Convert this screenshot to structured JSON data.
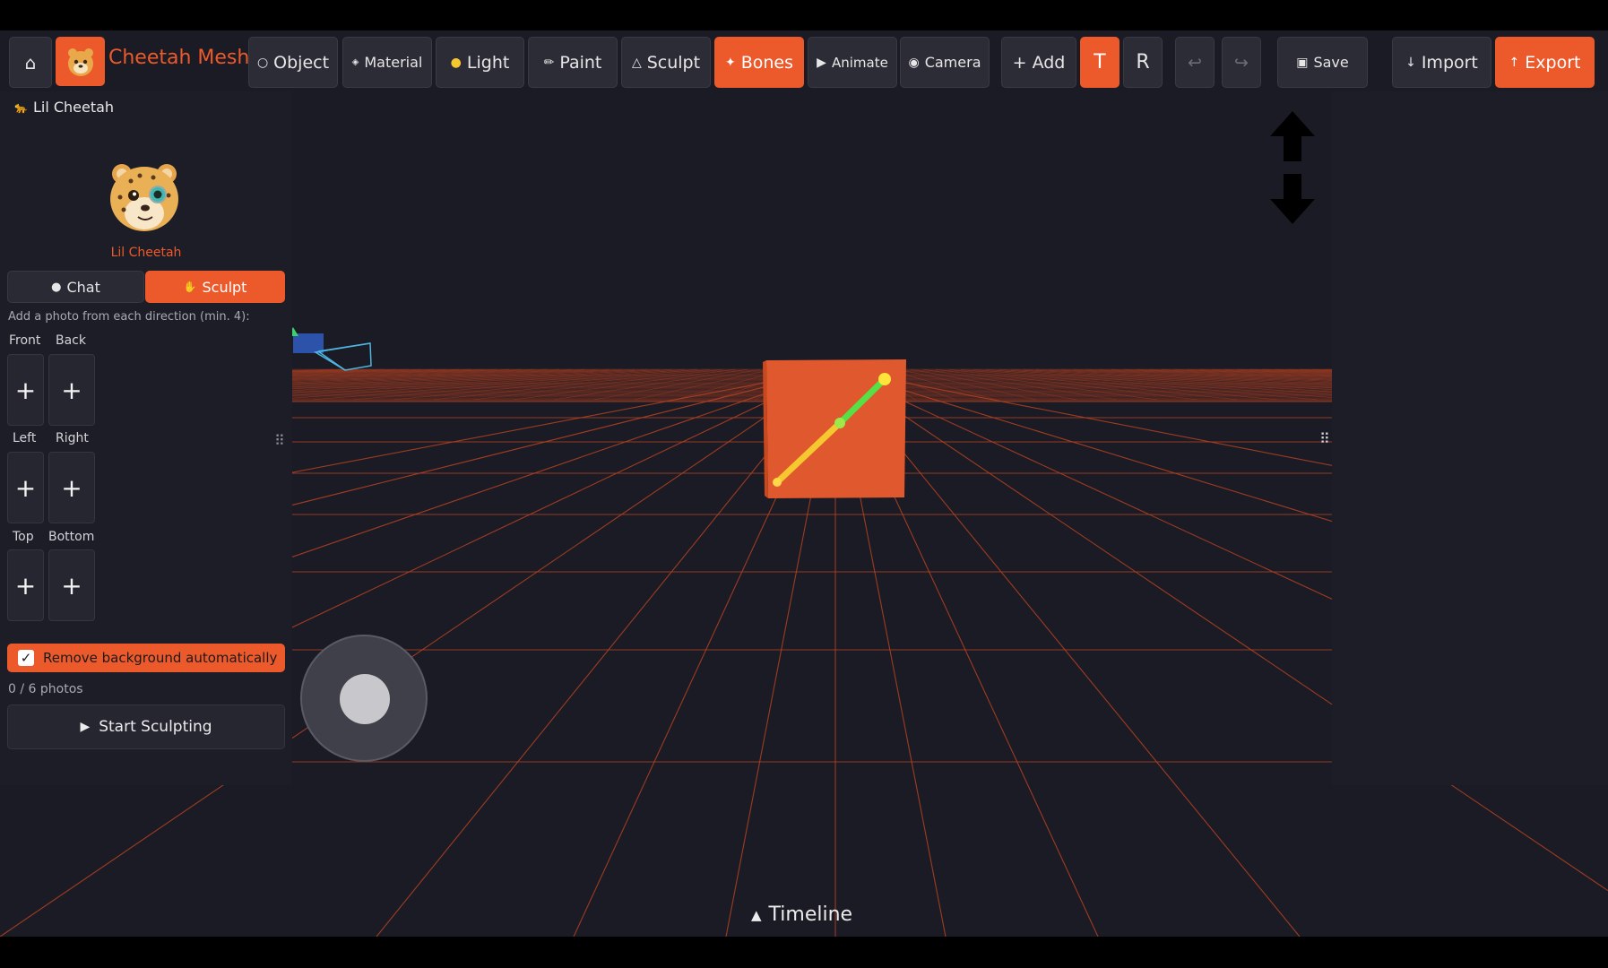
{
  "app": {
    "title": "Cheetah Mesh"
  },
  "toolbar": {
    "home_icon": "home-icon",
    "modes": [
      {
        "label": "Object",
        "icon": "○"
      },
      {
        "label": "Material",
        "icon": "◈"
      },
      {
        "label": "Light",
        "icon": "●"
      },
      {
        "label": "Paint",
        "icon": "✏"
      },
      {
        "label": "Sculpt",
        "icon": "△"
      },
      {
        "label": "Bones",
        "icon": "✦"
      },
      {
        "label": "Animate",
        "icon": "▶"
      },
      {
        "label": "Camera",
        "icon": "◉"
      }
    ],
    "active_mode": "Bones",
    "add_label": "+ Add",
    "transform_t": "T",
    "transform_r": "R",
    "undo_icon": "↩",
    "redo_icon": "↪",
    "save_label": "Save",
    "import_label": "Import",
    "export_label": "Export",
    "accent_color": "#ec5a2c"
  },
  "left_panel": {
    "header": "Lil Cheetah",
    "avatar_name": "Lil Cheetah",
    "tabs": {
      "chat": "Chat",
      "sculpt": "Sculpt"
    },
    "instructions": "Add a photo from each direction (min. 4):",
    "directions": {
      "front": "Front",
      "back": "Back",
      "left": "Left",
      "right": "Right",
      "top": "Top",
      "bottom": "Bottom"
    },
    "add_symbol": "+",
    "remove_background": {
      "label": "Remove background automatically",
      "checked": true
    },
    "photo_count": "0 / 6 photos",
    "start_button": "Start Sculpting"
  },
  "viewport": {
    "timeline_label": "Timeline",
    "grid_color": "#e0542a",
    "cube_color": "#e0582e"
  }
}
